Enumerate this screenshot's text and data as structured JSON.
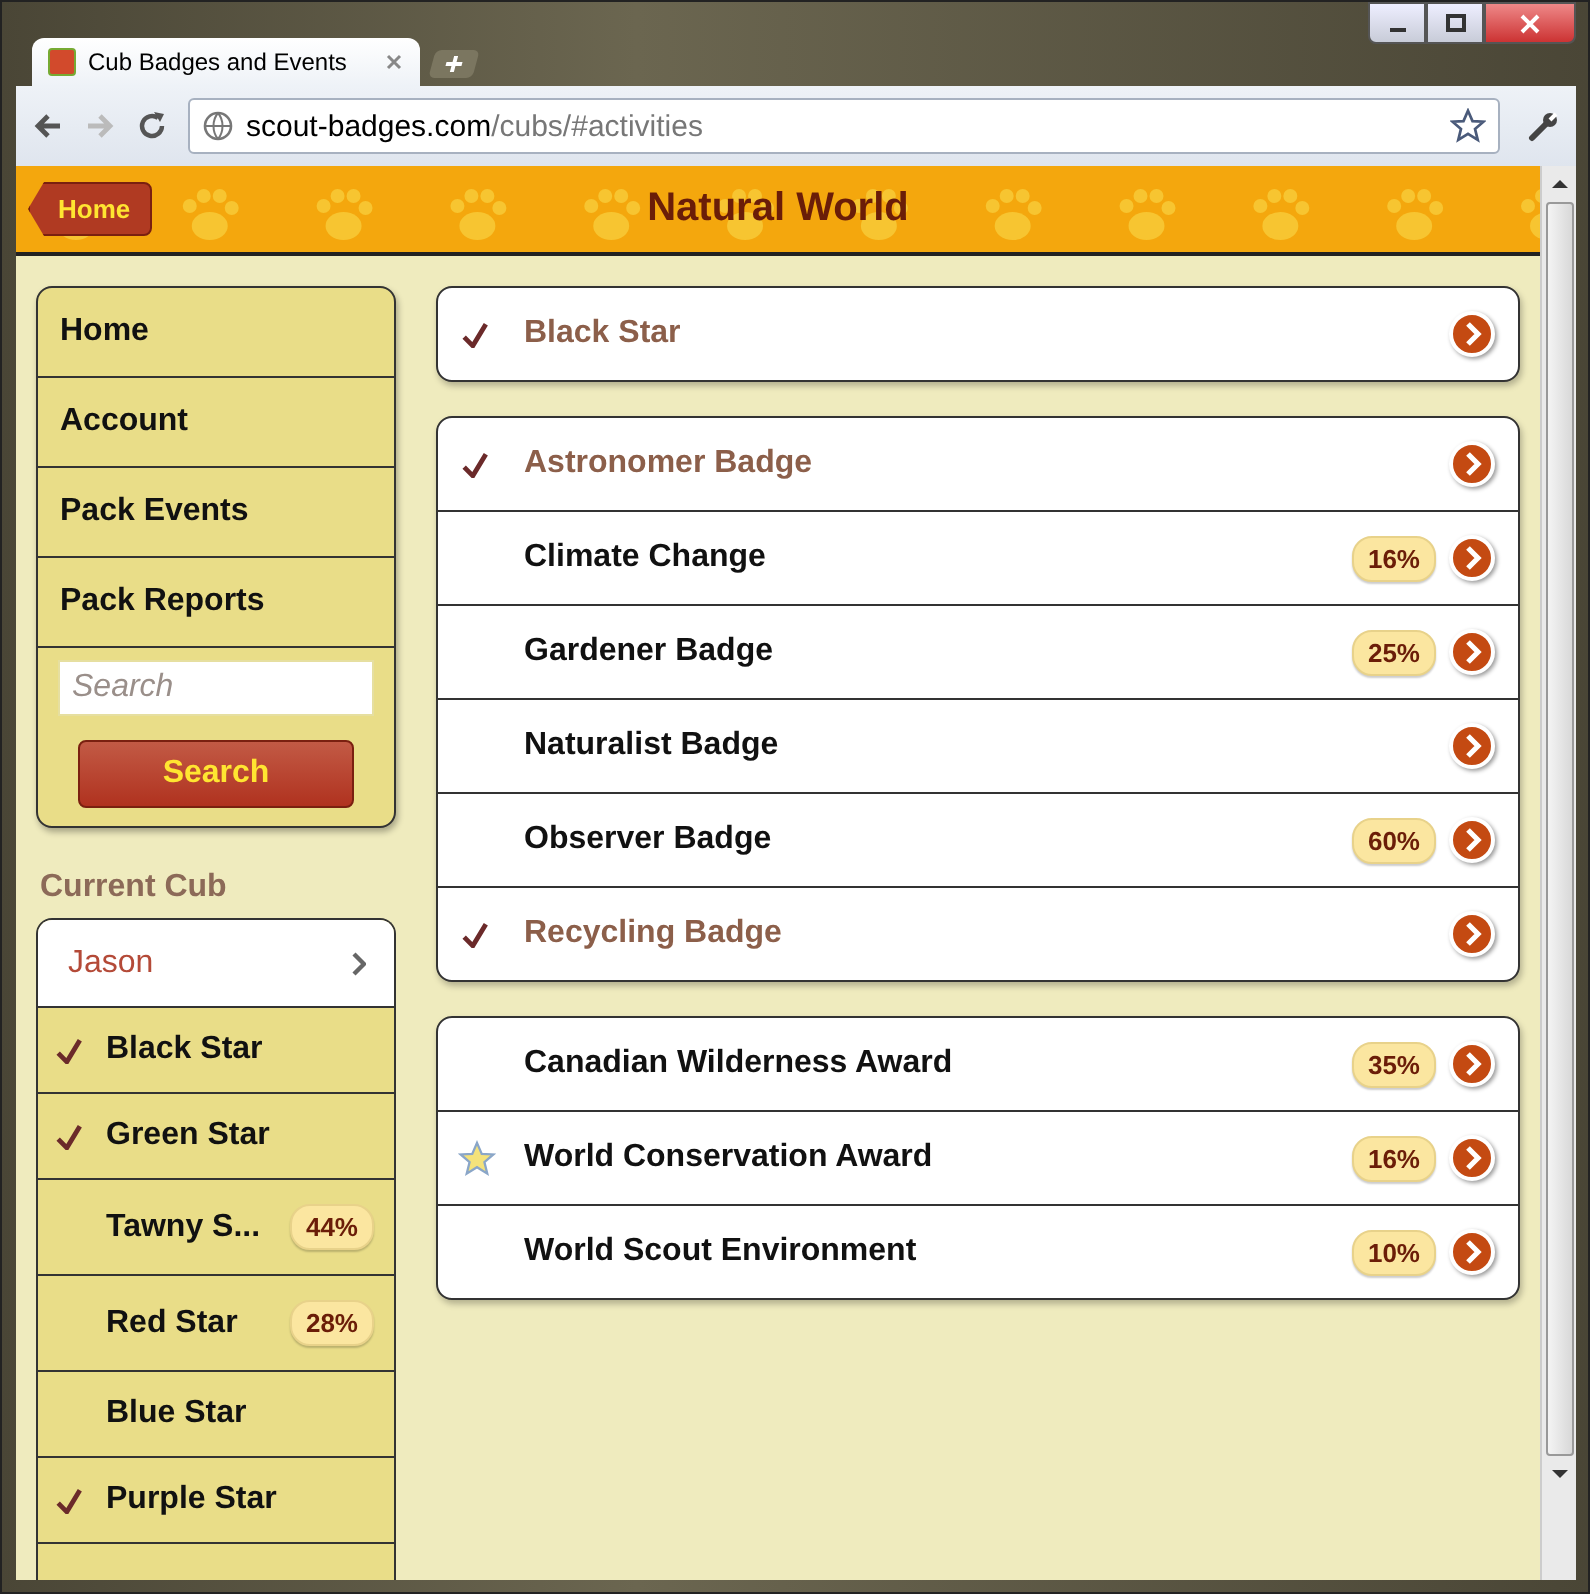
{
  "browser": {
    "tab_title": "Cub Badges and Events",
    "url_host": "scout-badges.com",
    "url_path": "/cubs/#activities"
  },
  "header": {
    "back_label": "Home",
    "title": "Natural World"
  },
  "sidebar": {
    "nav": [
      {
        "label": "Home"
      },
      {
        "label": "Account"
      },
      {
        "label": "Pack Events"
      },
      {
        "label": "Pack Reports"
      }
    ],
    "search": {
      "placeholder": "Search",
      "button": "Search"
    },
    "current_cub_heading": "Current Cub",
    "cub": "Jason",
    "stars": [
      {
        "label": "Black Star",
        "completed": true
      },
      {
        "label": "Green Star",
        "completed": true
      },
      {
        "label": "Tawny S...",
        "completed": false,
        "progress": "44%"
      },
      {
        "label": "Red Star",
        "completed": false,
        "progress": "28%"
      },
      {
        "label": "Blue Star",
        "completed": false
      },
      {
        "label": "Purple Star",
        "completed": true
      }
    ]
  },
  "groups": [
    {
      "items": [
        {
          "label": "Black Star",
          "completed": true,
          "starred": false
        }
      ]
    },
    {
      "items": [
        {
          "label": "Astronomer Badge",
          "completed": true,
          "starred": false
        },
        {
          "label": "Climate Change",
          "completed": false,
          "starred": false,
          "progress": "16%"
        },
        {
          "label": "Gardener Badge",
          "completed": false,
          "starred": false,
          "progress": "25%"
        },
        {
          "label": "Naturalist Badge",
          "completed": false,
          "starred": false
        },
        {
          "label": "Observer Badge",
          "completed": false,
          "starred": false,
          "progress": "60%"
        },
        {
          "label": "Recycling Badge",
          "completed": true,
          "starred": false
        }
      ]
    },
    {
      "items": [
        {
          "label": "Canadian Wilderness Award",
          "completed": false,
          "starred": false,
          "progress": "35%"
        },
        {
          "label": "World Conservation Award",
          "completed": false,
          "starred": true,
          "progress": "16%"
        },
        {
          "label": "World Scout Environment",
          "completed": false,
          "starred": false,
          "progress": "10%"
        }
      ]
    }
  ]
}
